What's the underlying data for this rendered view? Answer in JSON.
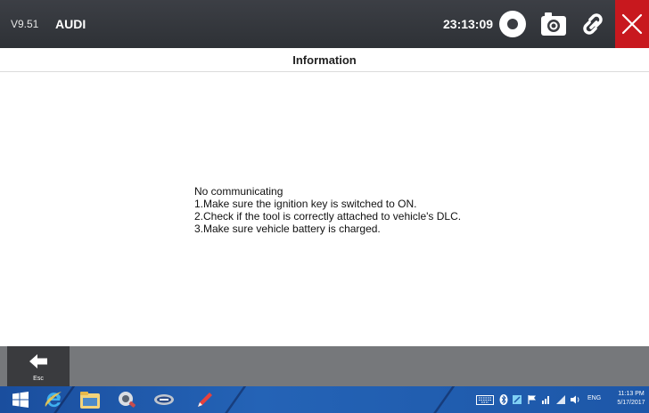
{
  "app": {
    "version": "V9.51",
    "vehicle_brand": "AUDI",
    "clock": "23:13:09",
    "toolbar_icons": [
      "record-icon",
      "camera-icon",
      "link-icon",
      "close-icon"
    ],
    "close_color": "#c8181e"
  },
  "dialog": {
    "title": "Information",
    "message_lines": [
      "No communicating",
      "1.Make sure the ignition key is switched to ON.",
      "2.Check if the tool is correctly attached to vehicle's DLC.",
      "3.Make sure vehicle battery is charged."
    ]
  },
  "bottom_toolbar": {
    "esc_label": "Esc",
    "esc_icon": "back-arrow-icon"
  },
  "taskbar": {
    "pinned_icons": [
      "windows-start-icon",
      "internet-explorer-icon",
      "file-explorer-icon",
      "diagnostic-app-icon",
      "car-app-icon",
      "pen-app-icon"
    ],
    "tray_icons": [
      "keyboard-icon",
      "bluetooth-icon",
      "app-tray-icon",
      "flag-icon",
      "signal-icon",
      "wifi-icon",
      "volume-icon"
    ],
    "language": "ENG",
    "time": "11:13 PM",
    "date": "5/17/2017",
    "bar_color": "#1d57a8"
  }
}
